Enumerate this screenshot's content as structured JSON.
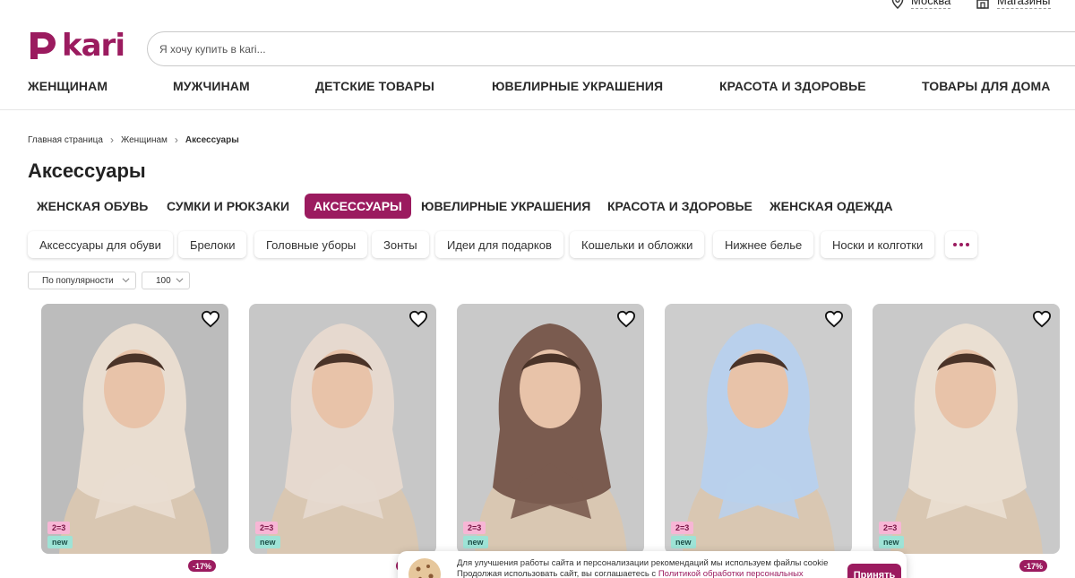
{
  "topbar": {
    "city": "Москва",
    "stores": "Магазины"
  },
  "header": {
    "logo_text": "kari",
    "search_placeholder": "Я хочу купить в kari..."
  },
  "main_nav": [
    "ЖЕНЩИНАМ",
    "МУЖЧИНАМ",
    "ДЕТСКИЕ ТОВАРЫ",
    "ЮВЕЛИРНЫЕ УКРАШЕНИЯ",
    "КРАСОТА И ЗДОРОВЬЕ",
    "ТОВАРЫ ДЛЯ ДОМА"
  ],
  "breadcrumb": {
    "home": "Главная страница",
    "section": "Женщинам",
    "current": "Аксессуары"
  },
  "page_title": "Аксессуары",
  "category_tabs": [
    "ЖЕНСКАЯ ОБУВЬ",
    "СУМКИ И РЮКЗАКИ",
    "АКСЕССУАРЫ",
    "ЮВЕЛИРНЫЕ УКРАШЕНИЯ",
    "КРАСОТА И ЗДОРОВЬЕ",
    "ЖЕНСКАЯ ОДЕЖДА"
  ],
  "active_category": "АКСЕССУАРЫ",
  "subcategories": [
    "Аксессуары для обуви",
    "Брелоки",
    "Головные уборы",
    "Зонты",
    "Идеи для подарков",
    "Кошельки и обложки",
    "Нижнее белье",
    "Носки и колготки"
  ],
  "sort": {
    "value": "По популярности"
  },
  "per_page": {
    "value": "100"
  },
  "products": [
    {
      "promo_badge": "2=3",
      "new_badge": "new",
      "scarf_color": "#e9ddd0",
      "bg_color": "#bcbcbc",
      "discount": "-17%"
    },
    {
      "promo_badge": "2=3",
      "new_badge": "new",
      "scarf_color": "#e6d9cf",
      "bg_color": "#c7c7c7",
      "discount": "-17%"
    },
    {
      "promo_badge": "2=3",
      "new_badge": "new",
      "scarf_color": "#7a5b4f",
      "bg_color": "#c9c9c9",
      "discount": ""
    },
    {
      "promo_badge": "2=3",
      "new_badge": "new",
      "scarf_color": "#b9d0ec",
      "bg_color": "#cdcdcd",
      "discount": ""
    },
    {
      "promo_badge": "2=3",
      "new_badge": "new",
      "scarf_color": "#eadfd2",
      "bg_color": "#c9c9c9",
      "discount": "-17%"
    }
  ],
  "cookie_banner": {
    "line1": "Для улучшения работы сайта и персонализации рекомендаций мы используем файлы cookie",
    "line2_prefix": "Продолжая использовать сайт, вы соглашаетесь с ",
    "line2_link": "Политикой обработки персональных данных",
    "accept": "Принять"
  },
  "colors": {
    "brand": "#9b1b5f",
    "promo": "#f7b6d5",
    "new": "#9ee3d6"
  }
}
